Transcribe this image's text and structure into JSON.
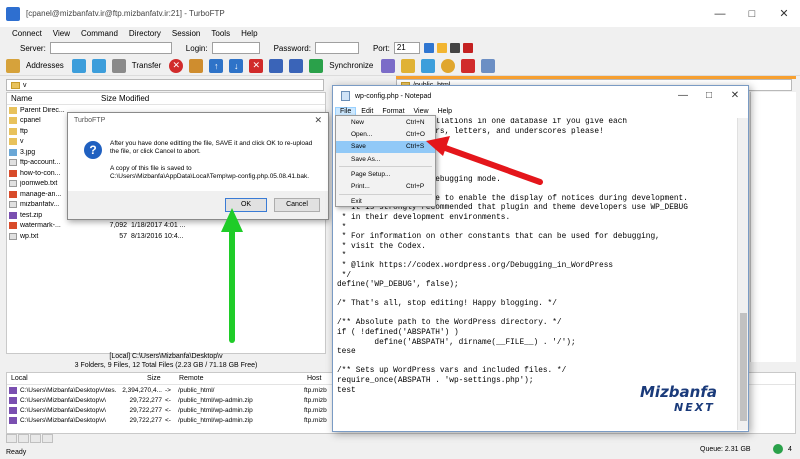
{
  "window": {
    "title": "[cpanel@mizbanfatv.ir@ftp.mizbanfatv.ir:21] - TurboFTP"
  },
  "menu": [
    "Connect",
    "View",
    "Command",
    "Directory",
    "Session",
    "Tools",
    "Help"
  ],
  "server_bar": {
    "server_label": "Server:",
    "login_label": "Login:",
    "password_label": "Password:",
    "port_label": "Port:",
    "port_value": "21"
  },
  "toolbar": {
    "addresses_label": "Addresses",
    "transfer_label": "Transfer",
    "synchronize_label": "Synchronize"
  },
  "left_pane": {
    "path": "v",
    "columns": {
      "name": "Name",
      "size": "Size",
      "modified": "Modified"
    },
    "files": [
      {
        "name": "Parent Direc...",
        "size": "",
        "modified": ""
      },
      {
        "name": "cpanel",
        "size": "",
        "modified": ""
      },
      {
        "name": "ftp",
        "size": "",
        "modified": ""
      },
      {
        "name": "v",
        "size": "",
        "modified": ""
      },
      {
        "name": "3.jpg",
        "size": "",
        "modified": ""
      },
      {
        "name": "ftp-account...",
        "size": "",
        "modified": ""
      },
      {
        "name": "how-to-con...",
        "size": "",
        "modified": ""
      },
      {
        "name": "joomweb.txt",
        "size": "",
        "modified": ""
      },
      {
        "name": "manage-an...",
        "size": "",
        "modified": ""
      },
      {
        "name": "mizbanfatv...",
        "size": "",
        "modified": ""
      },
      {
        "name": "test.zip",
        "size": "",
        "modified": ""
      },
      {
        "name": "watermark-...",
        "size": "7,092",
        "modified": "1/18/2017 4:01 ..."
      },
      {
        "name": "wp.txt",
        "size": "57",
        "modified": "8/13/2016 10:4..."
      }
    ],
    "status_line1": "[Local] C:\\Users\\Mizbanfa\\Desktop\\v",
    "status_line2": "3 Folders, 9 Files, 12 Total Files (2.23 GB / 71.18 GB Free)"
  },
  "right_pane": {
    "path": "/public_html"
  },
  "queue": {
    "columns": {
      "local": "Local",
      "size": "Size",
      "remote": "Remote",
      "host": "Host"
    },
    "rows": [
      {
        "local": "C:\\Users\\Mizbanfa\\Desktop\\v\\tes...",
        "size": "2,394,270,4...",
        "dir": "->",
        "remote": "/public_html/",
        "host": "ftp.mizb"
      },
      {
        "local": "C:\\Users\\Mizbanfa\\Desktop\\v\\",
        "size": "29,722,277",
        "dir": "<-",
        "remote": "/public_html/wp-admin.zip",
        "host": "ftp.mizb"
      },
      {
        "local": "C:\\Users\\Mizbanfa\\Desktop\\v\\",
        "size": "29,722,277",
        "dir": "<-",
        "remote": "/public_html/wp-admin.zip",
        "host": "ftp.mizb"
      },
      {
        "local": "C:\\Users\\Mizbanfa\\Desktop\\v\\",
        "size": "29,722,277",
        "dir": "<-",
        "remote": "/public_html/wp-admin.zip",
        "host": "ftp.mizb"
      }
    ]
  },
  "status": {
    "ready": "Ready",
    "queue": "Queue: 2.31 GB",
    "count": "4"
  },
  "dialog": {
    "title": "TurboFTP",
    "message": "After you have done editting the file, SAVE it and click OK to re-upload the file, or click Cancel to abort.",
    "copy_line1": "A copy of this file is saved to",
    "copy_line2": "C:\\Users\\Mizbanfa\\AppData\\Local\\Temp\\wp-config.php.05.08.41.bak.",
    "ok_label": "OK",
    "cancel_label": "Cancel"
  },
  "notepad": {
    "title": "wp-config.php - Notepad",
    "menu": [
      "File",
      "Edit",
      "Format",
      "View",
      "Help"
    ],
    "text": "              e installations in one database if you give each\n              y numbers, letters, and underscores please!\n\n\n\n\n              Press debugging mode.\n\n * Change this to true to enable the display of notices during development.\n * It is strongly recommended that plugin and theme developers use WP_DEBUG\n * in their development environments.\n *\n * For information on other constants that can be used for debugging,\n * visit the Codex.\n *\n * @link https://codex.wordpress.org/Debugging_in_WordPress\n */\ndefine('WP_DEBUG', false);\n\n/* That's all, stop editing! Happy blogging. */\n\n/** Absolute path to the WordPress directory. */\nif ( !defined('ABSPATH') )\n        define('ABSPATH', dirname(__FILE__) . '/');\ntese\n\n/** Sets up WordPress vars and included files. */\nrequire_once(ABSPATH . 'wp-settings.php');\ntest",
    "file_menu": [
      {
        "label": "New",
        "shortcut": "Ctrl+N"
      },
      {
        "label": "Open...",
        "shortcut": "Ctrl+O"
      },
      {
        "label": "Save",
        "shortcut": "Ctrl+S"
      },
      {
        "label": "Save As...",
        "shortcut": ""
      },
      {
        "label": "Page Setup...",
        "shortcut": ""
      },
      {
        "label": "Print...",
        "shortcut": "Ctrl+P"
      },
      {
        "label": "Exit",
        "shortcut": ""
      }
    ]
  },
  "brand": {
    "name": "Mizbanfa",
    "tag": "NEXT"
  },
  "colors": {
    "arrow_red": "#e4161b",
    "arrow_green": "#1fcc28",
    "highlight": "#91c9f7"
  }
}
